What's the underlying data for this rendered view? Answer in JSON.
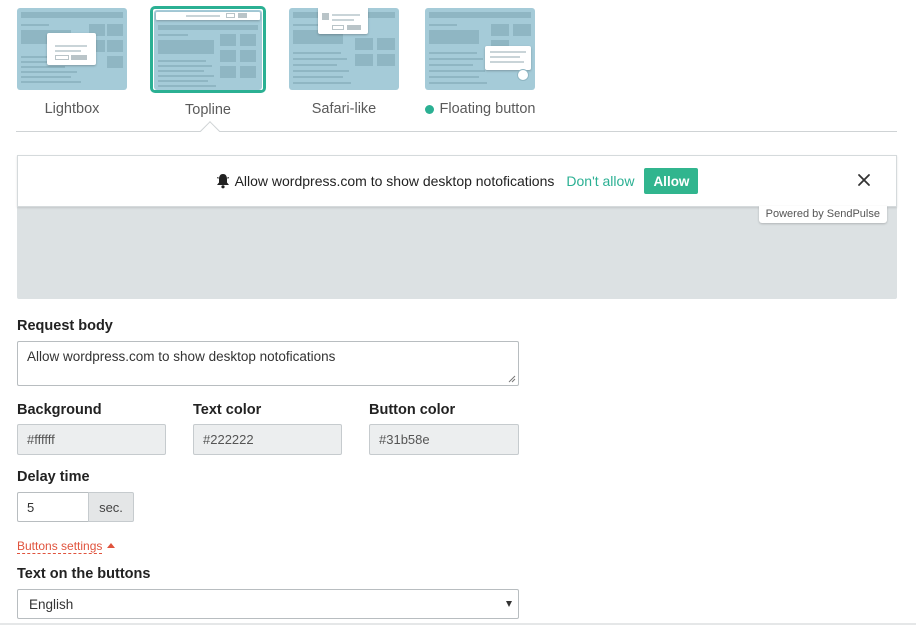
{
  "layouts": [
    {
      "label": "Lightbox",
      "active": false,
      "dot": false
    },
    {
      "label": "Topline",
      "active": true,
      "dot": false
    },
    {
      "label": "Safari-like",
      "active": false,
      "dot": false
    },
    {
      "label": "Floating button",
      "active": false,
      "dot": true
    }
  ],
  "preview": {
    "message": "Allow wordpress.com to show desktop notofications",
    "dont_allow": "Don't allow",
    "allow": "Allow",
    "powered_by": "Powered by SendPulse"
  },
  "form": {
    "request_body_label": "Request body",
    "request_body_value": "Allow wordpress.com to show desktop notofications",
    "background_label": "Background",
    "background_value": "#ffffff",
    "text_color_label": "Text color",
    "text_color_value": "#222222",
    "button_color_label": "Button color",
    "button_color_value": "#31b58e",
    "delay_label": "Delay time",
    "delay_value": "5",
    "delay_unit": "sec.",
    "buttons_settings_link": "Buttons settings",
    "buttons_text_label": "Text on the buttons",
    "language_value": "English"
  },
  "colors": {
    "accent": "#2bb093",
    "allow_button": "#31b58e",
    "link": "#e0533d",
    "thumb_bg": "#a5cbd8",
    "preview_bg": "#dce1e3"
  },
  "icons": {
    "bell": "bell-icon",
    "close": "close-icon",
    "select_arrow": "chevron-down-icon",
    "link_caret": "caret-up-icon"
  }
}
